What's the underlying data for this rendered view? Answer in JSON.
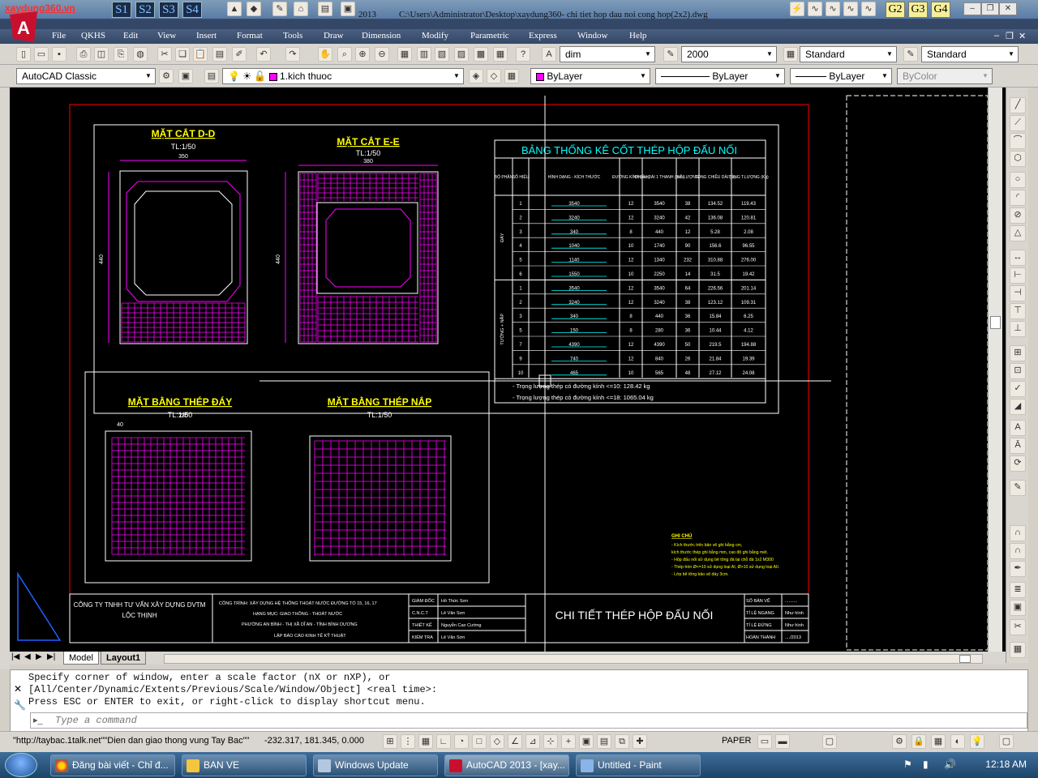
{
  "titlebar": {
    "watermark": "xaydung360.vn",
    "quick_buttons": [
      "S1",
      "S2",
      "S3",
      "S4"
    ],
    "version_fragment": "2013",
    "doc_path": "C:\\Users\\Administrator\\Desktop\\xaydung360- chi tiet hop dau noi cong hop(2x2).dwg",
    "g_buttons": [
      "G2",
      "G3",
      "G4"
    ]
  },
  "menu": [
    "File",
    "QKHS",
    "Edit",
    "View",
    "Insert",
    "Format",
    "Tools",
    "Draw",
    "Dimension",
    "Modify",
    "Parametric",
    "Express",
    "Window",
    "Help"
  ],
  "toolbar1": {
    "text_style": "dim",
    "dim_scale": "2000",
    "table_style": "Standard",
    "multileader_style": "Standard"
  },
  "toolbar2": {
    "workspace": "AutoCAD Classic",
    "layer": "1.kich thuoc",
    "color": "ByLayer",
    "linetype": "ByLayer",
    "lineweight": "ByLayer",
    "plotstyle": "ByColor"
  },
  "drawing": {
    "sec_dd": "MẶT CẮT D-D",
    "sec_ee": "MẶT CẮT E-E",
    "scale": "TL:1/50",
    "plan_bottom": "MẶT BẰNG THÉP ĐÁY",
    "plan_top": "MẶT BẰNG THÉP NẮP",
    "dim_350": "350",
    "dim_380": "380",
    "dim_440": "440",
    "dim_230": "230",
    "dim_40": "40",
    "table_title": "BẢNG THỐNG KÊ CỐT THÉP HỘP ĐẤU NỐI",
    "table_headers": [
      "BỘ PHẬN",
      "SỐ HIỆU",
      "HÌNH DẠNG - KÍCH THƯỚC",
      "ĐƯỜNG KÍNH (mm)",
      "CHIỀU DÀI 1 THANH (mm)",
      "SỐ LƯỢNG",
      "TỔNG CHIỀU DÀI (m)",
      "TỔNG T.LƯỢNG (Kg)"
    ],
    "group_bottom": "ĐÁY",
    "group_top": "TƯỜNG + NẮP",
    "rows_bottom": [
      [
        "1",
        "3540",
        "12",
        "3540",
        "38",
        "134.52",
        "119.43"
      ],
      [
        "2",
        "3240",
        "12",
        "3240",
        "42",
        "136.08",
        "120.81"
      ],
      [
        "3",
        "340",
        "8",
        "440",
        "12",
        "5.28",
        "2.08"
      ],
      [
        "4",
        "1040",
        "10",
        "1740",
        "90",
        "156.6",
        "96.55"
      ],
      [
        "5",
        "1140",
        "12",
        "1340",
        "232",
        "310.88",
        "276.00"
      ],
      [
        "6",
        "1550",
        "10",
        "2250",
        "14",
        "31.5",
        "19.42"
      ]
    ],
    "rows_top": [
      [
        "1",
        "3540",
        "12",
        "3540",
        "64",
        "226.56",
        "201.14"
      ],
      [
        "2",
        "3240",
        "12",
        "3240",
        "38",
        "123.12",
        "109.31"
      ],
      [
        "3",
        "340",
        "8",
        "440",
        "36",
        "15.84",
        "6.25"
      ],
      [
        "5",
        "150",
        "8",
        "280",
        "36",
        "10.44",
        "4.12"
      ],
      [
        "7",
        "4390",
        "12",
        "4390",
        "50",
        "219.5",
        "194.88"
      ],
      [
        "9",
        "740",
        "12",
        "840",
        "26",
        "21.84",
        "19.39"
      ],
      [
        "10",
        "465",
        "10",
        "565",
        "48",
        "27.12",
        "24.08"
      ]
    ],
    "summary1": "- Trọng lượng thép có đường kính <=10:   128.42 kg",
    "summary2": "- Trọng lượng thép có đường kính <=18:   1065.04 kg",
    "notes_title": "GHI CHÚ",
    "notes": [
      "- Kích thước trên bản vẽ ghi bằng cm,",
      "  kích thước thép ghi bằng mm, cao độ ghi bằng mét.",
      "- Hộp đấu nối sử dụng bê tông đá tại chỗ đá 1x2 M300",
      "- Thép tròn Ø<=10 sử dụng loại AI, Ø>10 sử dụng loại AII.",
      "- Lớp bê tông bảo vệ dày 3cm."
    ],
    "company": "CÔNG TY TNHH TƯ VẤN XÂY DỰNG DVTM",
    "company2": "LỘC THỊNH",
    "project_lines": [
      "CÔNG TRÌNH:  XÂY DỰNG HỆ THỐNG THOÁT NƯỚC ĐƯỜNG TỔ 15, 16, 17",
      "HẠNG MỤC:  GIAO THÔNG - THOÁT NƯỚC",
      "PHƯỜNG AN BÌNH - THỊ XÃ DĨ AN - TỈNH BÌNH DƯƠNG",
      "LẬP BÁO CÁO KINH TẾ KỸ THUẬT"
    ],
    "signers": [
      [
        "GIÁM ĐỐC",
        "Hồ Thức Sơn"
      ],
      [
        "C.N.C.T",
        "Lê Văn Sơn"
      ],
      [
        "THIẾT KẾ",
        "Nguyễn Cao Cường"
      ],
      [
        "KIỂM TRA",
        "Lê Văn Sơn"
      ]
    ],
    "sheet_title": "CHI TIẾT THÉP HỘP ĐẤU NỐI",
    "sheet_info": [
      [
        "SỐ BẢN VẼ",
        ".........."
      ],
      [
        "TỈ LỆ NGANG",
        "Như hình"
      ],
      [
        "TỈ LỆ ĐỨNG",
        "Như hình"
      ],
      [
        "HOÀN THÀNH",
        "..../2013"
      ]
    ]
  },
  "tabs": [
    "Model",
    "Layout1"
  ],
  "command": {
    "line1": "Specify corner of window, enter a scale factor (nX or nXP), or",
    "line2": "[All/Center/Dynamic/Extents/Previous/Scale/Window/Object] <real time>:",
    "line3": "Press ESC or ENTER to exit, or right-click to display shortcut menu.",
    "placeholder": "Type a command"
  },
  "status": {
    "url": "\"http://taybac.1talk.net\"\"Dien dan giao thong vung Tay Bac\"\"",
    "coords": "-232.317, 181.345, 0.000",
    "space": "PAPER"
  },
  "taskbar": {
    "items": [
      "Đăng bài viết - Chỉ đ...",
      "BAN VE",
      "Windows Update",
      "AutoCAD 2013 - [xay...",
      "Untitled - Paint"
    ],
    "time": "12:18 AM"
  },
  "colors": {
    "accent_yellow": "#ffff00",
    "cad_red": "#ff0000",
    "cad_magenta": "#ff00ff",
    "cad_cyan": "#00ffff"
  }
}
